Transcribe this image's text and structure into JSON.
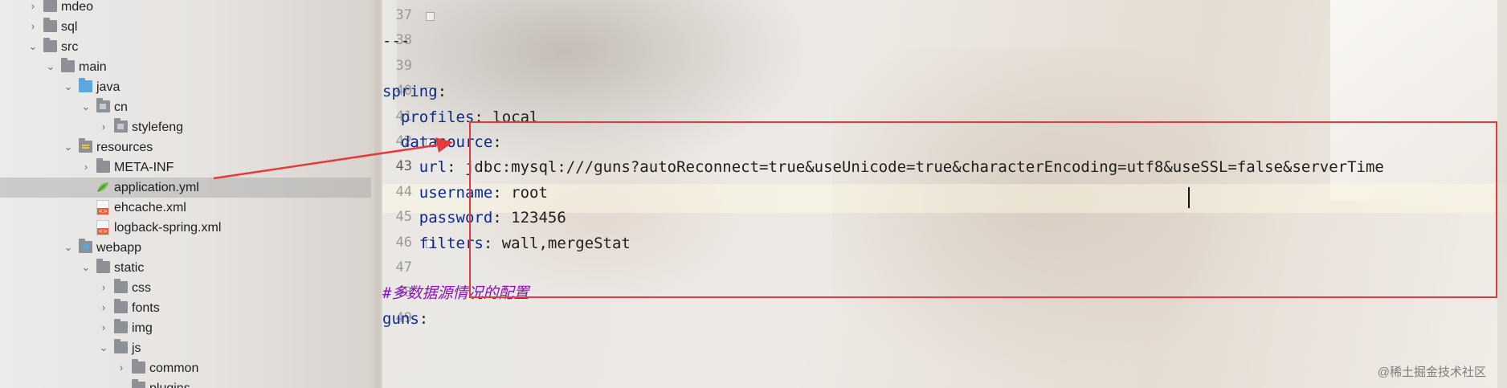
{
  "tree": {
    "items": [
      {
        "label": "mdeo",
        "depth": 1,
        "chevron": "right",
        "icon": "folder-icon"
      },
      {
        "label": "sql",
        "depth": 1,
        "chevron": "right",
        "icon": "folder-icon"
      },
      {
        "label": "src",
        "depth": 1,
        "chevron": "down",
        "icon": "folder-icon"
      },
      {
        "label": "main",
        "depth": 2,
        "chevron": "down",
        "icon": "folder-icon"
      },
      {
        "label": "java",
        "depth": 3,
        "chevron": "down",
        "icon": "source-folder-icon"
      },
      {
        "label": "cn",
        "depth": 4,
        "chevron": "down",
        "icon": "package-folder-icon"
      },
      {
        "label": "stylefeng",
        "depth": 5,
        "chevron": "right",
        "icon": "package-folder-icon"
      },
      {
        "label": "resources",
        "depth": 3,
        "chevron": "down",
        "icon": "resources-folder-icon"
      },
      {
        "label": "META-INF",
        "depth": 4,
        "chevron": "right",
        "icon": "folder-icon"
      },
      {
        "label": "application.yml",
        "depth": 4,
        "chevron": "",
        "icon": "yml-file-icon",
        "selected": true
      },
      {
        "label": "ehcache.xml",
        "depth": 4,
        "chevron": "",
        "icon": "xml-file-icon"
      },
      {
        "label": "logback-spring.xml",
        "depth": 4,
        "chevron": "",
        "icon": "xml-file-icon"
      },
      {
        "label": "webapp",
        "depth": 3,
        "chevron": "down",
        "icon": "web-folder-icon"
      },
      {
        "label": "static",
        "depth": 4,
        "chevron": "down",
        "icon": "folder-icon"
      },
      {
        "label": "css",
        "depth": 5,
        "chevron": "right",
        "icon": "folder-icon"
      },
      {
        "label": "fonts",
        "depth": 5,
        "chevron": "right",
        "icon": "folder-icon"
      },
      {
        "label": "img",
        "depth": 5,
        "chevron": "right",
        "icon": "folder-icon"
      },
      {
        "label": "js",
        "depth": 5,
        "chevron": "down",
        "icon": "folder-icon"
      },
      {
        "label": "common",
        "depth": 6,
        "chevron": "right",
        "icon": "folder-icon"
      },
      {
        "label": "plugins",
        "depth": 6,
        "chevron": "down",
        "icon": "folder-icon"
      }
    ]
  },
  "editor": {
    "current_line": "43",
    "lines": [
      {
        "number": "37",
        "parts": []
      },
      {
        "number": "38",
        "parts": [
          {
            "t": "---",
            "c": "plain"
          }
        ]
      },
      {
        "number": "39",
        "parts": []
      },
      {
        "number": "40",
        "parts": [
          {
            "t": "spring",
            "c": "k"
          },
          {
            "t": ":",
            "c": "plain"
          }
        ]
      },
      {
        "number": "41",
        "parts": [
          {
            "t": "  ",
            "c": "plain"
          },
          {
            "t": "profiles",
            "c": "k"
          },
          {
            "t": ": local",
            "c": "plain"
          }
        ]
      },
      {
        "number": "42",
        "parts": [
          {
            "t": "  ",
            "c": "plain"
          },
          {
            "t": "datasource",
            "c": "k"
          },
          {
            "t": ":",
            "c": "plain"
          }
        ]
      },
      {
        "number": "43",
        "parts": [
          {
            "t": "    ",
            "c": "plain"
          },
          {
            "t": "url",
            "c": "k"
          },
          {
            "t": ": jdbc:mysql:///guns?autoReconnect=true&useUnicode=true&characterEncoding=utf8&useSSL=false&serverTime",
            "c": "plain"
          }
        ]
      },
      {
        "number": "44",
        "parts": [
          {
            "t": "    ",
            "c": "plain"
          },
          {
            "t": "username",
            "c": "k"
          },
          {
            "t": ": root",
            "c": "plain"
          }
        ]
      },
      {
        "number": "45",
        "parts": [
          {
            "t": "    ",
            "c": "plain"
          },
          {
            "t": "password",
            "c": "k"
          },
          {
            "t": ": 123456",
            "c": "plain"
          }
        ]
      },
      {
        "number": "46",
        "parts": [
          {
            "t": "    ",
            "c": "plain"
          },
          {
            "t": "filters",
            "c": "k"
          },
          {
            "t": ": wall,mergeStat",
            "c": "plain"
          }
        ]
      },
      {
        "number": "47",
        "parts": []
      },
      {
        "number": "48",
        "parts": [
          {
            "t": "#多数据源情况的配置",
            "c": "comment"
          }
        ]
      },
      {
        "number": "49",
        "parts": [
          {
            "t": "guns",
            "c": "k"
          },
          {
            "t": ":",
            "c": "plain"
          }
        ]
      }
    ]
  },
  "colors": {
    "annotation_red": "#e53a3a",
    "yaml_key": "#0b2a8c",
    "comment_purple": "#8a0fbd"
  },
  "watermark": "@稀土掘金技术社区"
}
